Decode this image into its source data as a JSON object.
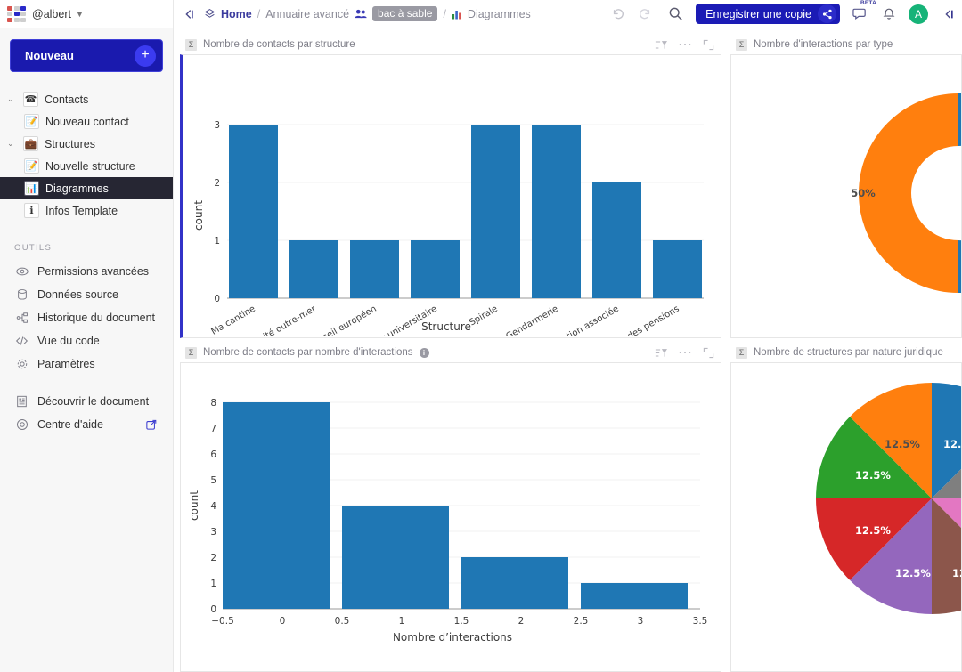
{
  "topbar": {
    "user": "@albert",
    "collapse_left_icon": "collapse-left-icon",
    "home_label": "Home",
    "sep": "/",
    "crumb2": "Annuaire avancé",
    "crumb_chip": "bac à sable",
    "crumb3": "Diagrammes",
    "undo_icon": "undo-icon",
    "redo_icon": "redo-icon",
    "search_icon": "search-icon",
    "save_label": "Enregistrer une copie",
    "share_icon": "share-icon",
    "chat_icon": "chat-icon",
    "beta_label": "BETA",
    "bell_icon": "bell-icon",
    "avatar_initial": "A",
    "collapse_right_icon": "collapse-right-icon"
  },
  "sidebar": {
    "new_button": "Nouveau",
    "new_plus": "+",
    "pages": [
      {
        "label": "Contacts",
        "icon": "phone-icon",
        "glyph": "☎",
        "child": false,
        "chevron": "⌄",
        "active": false
      },
      {
        "label": "Nouveau contact",
        "icon": "note-pencil-icon",
        "glyph": "📝",
        "child": true,
        "chevron": "",
        "active": false
      },
      {
        "label": "Structures",
        "icon": "briefcase-icon",
        "glyph": "💼",
        "child": false,
        "chevron": "⌄",
        "active": false
      },
      {
        "label": "Nouvelle structure",
        "icon": "note-pencil-icon",
        "glyph": "📝",
        "child": true,
        "chevron": "",
        "active": false
      },
      {
        "label": "Diagrammes",
        "icon": "bar-chart-icon",
        "glyph": "📊",
        "child": true,
        "chevron": "",
        "active": true
      },
      {
        "label": "Infos Template",
        "icon": "info-icon",
        "glyph": "ℹ",
        "child": true,
        "chevron": "",
        "active": false
      }
    ],
    "tools_header": "OUTILS",
    "tools": [
      {
        "label": "Permissions avancées",
        "icon": "eye-icon"
      },
      {
        "label": "Données source",
        "icon": "database-icon"
      },
      {
        "label": "Historique du document",
        "icon": "history-icon"
      },
      {
        "label": "Vue du code",
        "icon": "code-icon"
      },
      {
        "label": "Paramètres",
        "icon": "gear-icon"
      }
    ],
    "tools_footer": [
      {
        "label": "Découvrir le document",
        "icon": "document-icon",
        "external": false
      },
      {
        "label": "Centre d'aide",
        "icon": "help-icon",
        "external": true
      }
    ]
  },
  "widgets": [
    {
      "title": "Nombre de contacts par structure",
      "sigma": "Σ",
      "has_info": false,
      "selected": true,
      "filter_icon": "filter-sort-icon",
      "more_icon": "more-options-icon",
      "expand_icon": "expand-icon"
    },
    {
      "title": "Nombre d'interactions par type",
      "sigma": "Σ",
      "has_info": false,
      "selected": false,
      "filter_icon": "",
      "more_icon": "",
      "expand_icon": ""
    },
    {
      "title": "Nombre de contacts par nombre d'interactions",
      "sigma": "Σ",
      "has_info": true,
      "info_glyph": "i",
      "selected": false,
      "filter_icon": "filter-sort-icon",
      "more_icon": "more-options-icon",
      "expand_icon": "expand-icon"
    },
    {
      "title": "Nombre de structures par nature juridique",
      "sigma": "Σ",
      "has_info": false,
      "selected": false,
      "filter_icon": "",
      "more_icon": "",
      "expand_icon": ""
    }
  ],
  "chart_data": [
    {
      "type": "bar",
      "title": "Nombre de contacts par structure",
      "xlabel": "Structure",
      "ylabel": "count",
      "categories": [
        "Ma cantine",
        "Collectivité outre-mer",
        "Conseil européen",
        "Centre hospitalier universitaire",
        "Spirale",
        "Gendarmerie",
        "Association associée",
        "Service des pensions"
      ],
      "values": [
        3,
        1,
        1,
        1,
        3,
        3,
        2,
        1
      ],
      "yticks": [
        0,
        1,
        2,
        3
      ],
      "ylim": [
        0,
        3.15
      ],
      "bar_color": "#1f77b4",
      "grid": true,
      "legend": "none"
    },
    {
      "type": "pie",
      "variant": "donut",
      "title": "Nombre d'interactions par type",
      "labels": [
        "50%",
        "50%"
      ],
      "values": [
        50,
        50
      ],
      "colors": [
        "#ff7f0e",
        "#1f77b4"
      ],
      "visible_label": "50%",
      "legend": "none"
    },
    {
      "type": "bar",
      "subtype": "histogram",
      "title": "Nombre de contacts par nombre d'interactions",
      "xlabel": "Nombre d'interactions",
      "ylabel": "count",
      "x": [
        0,
        1,
        2,
        3
      ],
      "values": [
        8,
        4,
        2,
        1
      ],
      "xticks": [
        "−0.5",
        "0",
        "0.5",
        "1",
        "1.5",
        "2",
        "2.5",
        "3",
        "3.5"
      ],
      "yticks": [
        0,
        1,
        2,
        3,
        4,
        5,
        6,
        7,
        8
      ],
      "xlim": [
        -0.5,
        3.5
      ],
      "ylim": [
        0,
        8.2
      ],
      "bar_color": "#1f77b4",
      "grid": true,
      "legend": "none"
    },
    {
      "type": "pie",
      "title": "Nombre de structures par nature juridique",
      "labels": [
        "12.5%",
        "12.5%",
        "12.5%",
        "12.5%",
        "12.5%",
        "12.5%",
        "12.5%",
        "12.5%"
      ],
      "values": [
        12.5,
        12.5,
        12.5,
        12.5,
        12.5,
        12.5,
        12.5,
        12.5
      ],
      "colors": [
        "#1f77b4",
        "#ff7f0e",
        "#2ca02c",
        "#d62728",
        "#9467bd",
        "#8c564b",
        "#e377c2",
        "#7f7f7f"
      ],
      "legend": "none"
    }
  ]
}
